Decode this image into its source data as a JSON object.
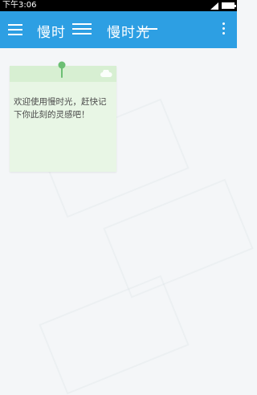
{
  "status_bar": {
    "time": "下午3:06"
  },
  "app_bar": {
    "title_left": "慢时",
    "title_right": "慢时光"
  },
  "note": {
    "text": "欢迎使用慢时光，赶快记下你此刻的灵感吧！"
  },
  "colors": {
    "primary": "#2d9fe3",
    "note_background": "#e8f6e5",
    "note_header": "#d7efd2",
    "pin": "#6cbf74"
  },
  "icons": {
    "menu": "menu-icon",
    "overflow": "more-vert-icon",
    "pin": "pin-icon",
    "cloud": "cloud-icon"
  }
}
